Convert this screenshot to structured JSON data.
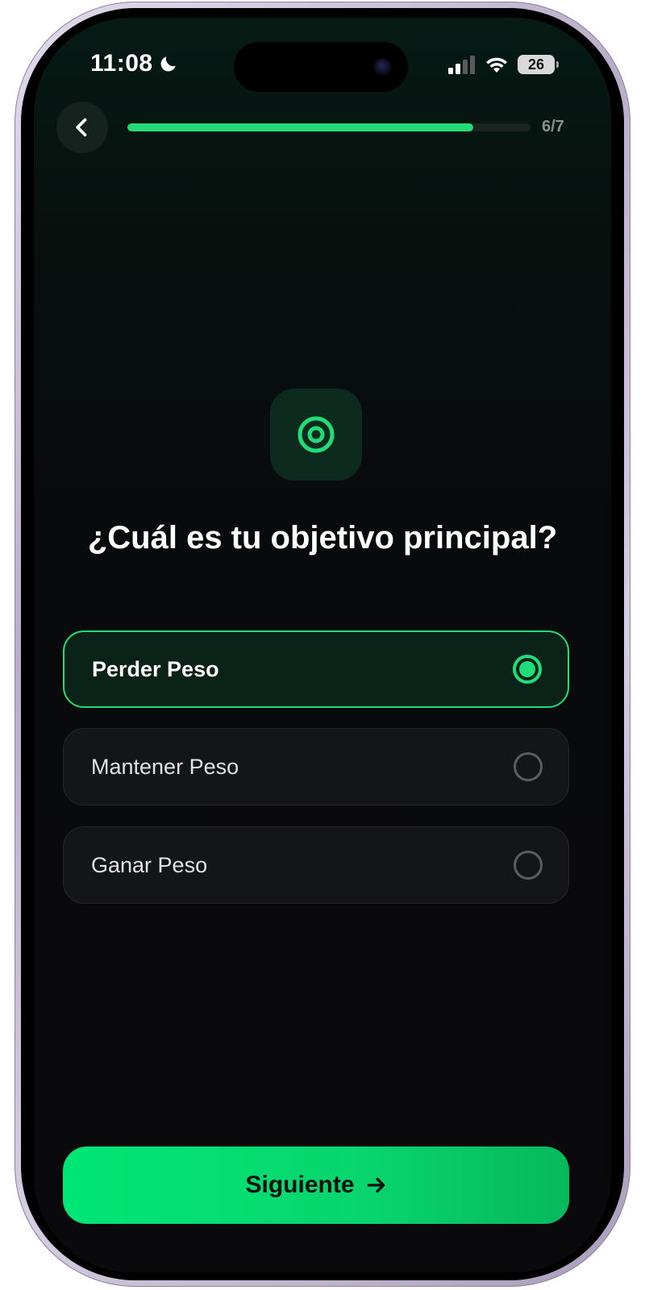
{
  "status_bar": {
    "time": "11:08",
    "battery": "26",
    "icons": [
      "moon-icon",
      "signal-icon",
      "wifi-icon",
      "battery-icon"
    ]
  },
  "header": {
    "back_icon": "chevron-left-icon",
    "progress_fraction": 0.857,
    "step_counter": "6/7"
  },
  "hero": {
    "icon": "target-icon",
    "question": "¿Cuál es tu objetivo principal?"
  },
  "options": [
    {
      "label": "Perder Peso",
      "selected": true
    },
    {
      "label": "Mantener Peso",
      "selected": false
    },
    {
      "label": "Ganar Peso",
      "selected": false
    }
  ],
  "next_button": {
    "label": "Siguiente",
    "icon": "arrow-right-icon"
  },
  "colors": {
    "accent": "#22dd77",
    "background": "#0a0a0c",
    "option_selected_bg": "#0b2219",
    "option_bg": "#141519"
  }
}
